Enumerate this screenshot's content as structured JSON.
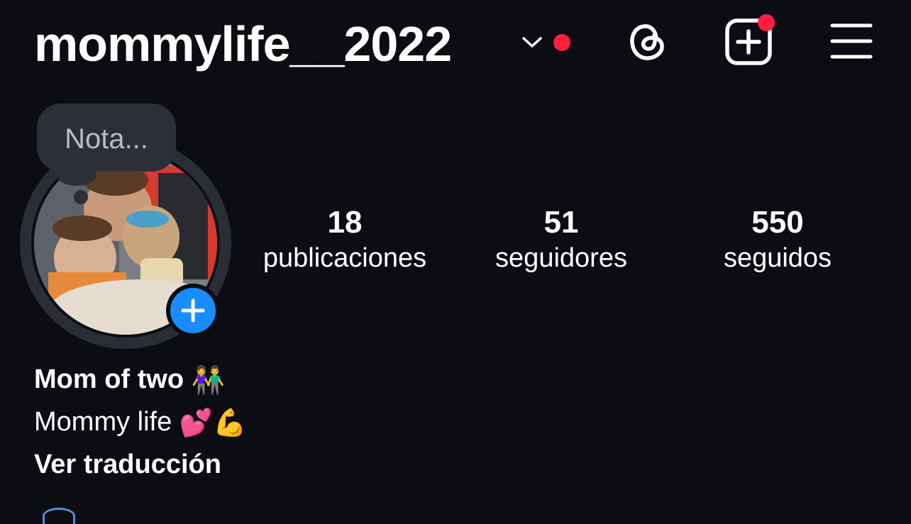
{
  "header": {
    "username": "mommylife__2022",
    "icons": {
      "account_switcher": "chevron-down-icon",
      "notification_dot": "red-dot-icon",
      "threads": "threads-icon",
      "create": "plus-square-icon",
      "menu": "hamburger-menu-icon"
    },
    "colors": {
      "notification": "#ff1f3d",
      "background": "#0b0d12"
    }
  },
  "profile": {
    "note_placeholder": "Nota...",
    "add_story_icon": "plus-icon",
    "add_story_color": "#1a8cff"
  },
  "stats": [
    {
      "value": "18",
      "label": "publicaciones"
    },
    {
      "value": "51",
      "label": "seguidores"
    },
    {
      "value": "550",
      "label": "seguidos"
    }
  ],
  "bio": {
    "name": "Mom of two",
    "name_emoji": "👫",
    "line2": "Mommy life",
    "line2_emojis": [
      "💕",
      "💪"
    ],
    "translate": "Ver traducción"
  }
}
